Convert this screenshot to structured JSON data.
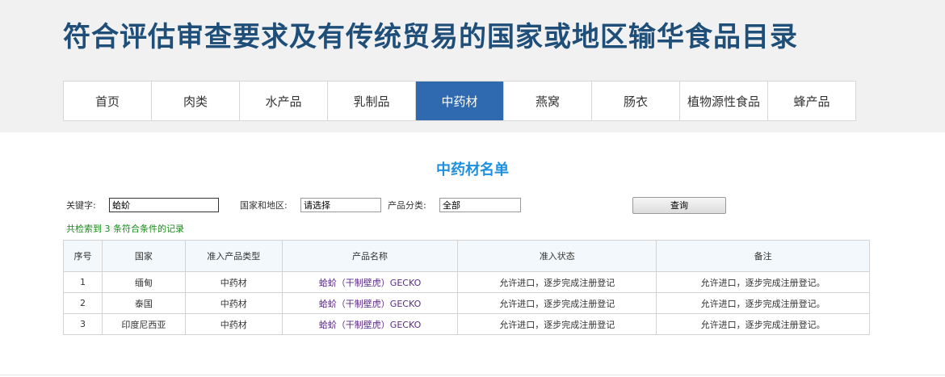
{
  "header": {
    "title": "符合评估审查要求及有传统贸易的国家或地区输华食品目录"
  },
  "nav": {
    "active_index": 4,
    "items": [
      "首页",
      "肉类",
      "水产品",
      "乳制品",
      "中药材",
      "燕窝",
      "肠衣",
      "植物源性食品",
      "蜂产品"
    ]
  },
  "section": {
    "title": "中药材名单"
  },
  "search": {
    "keyword_label": "关键字:",
    "keyword_value": "蛤蚧",
    "region_label": "国家和地区:",
    "region_value": "请选择",
    "category_label": "产品分类:",
    "category_value": "全部",
    "query_button": "查询"
  },
  "results": {
    "summary": "共检索到 3 条符合条件的记录",
    "columns": [
      "序号",
      "国家",
      "准入产品类型",
      "产品名称",
      "准入状态",
      "备注"
    ],
    "rows": [
      [
        "1",
        "缅甸",
        "中药材",
        "蛤蚧（干制壁虎）GECKO",
        "允许进口，逐步完成注册登记",
        "允许进口，逐步完成注册登记。"
      ],
      [
        "2",
        "泰国",
        "中药材",
        "蛤蚧（干制壁虎）GECKO",
        "允许进口，逐步完成注册登记",
        "允许进口，逐步完成注册登记。"
      ],
      [
        "3",
        "印度尼西亚",
        "中药材",
        "蛤蚧（干制壁虎）GECKO",
        "允许进口，逐步完成注册登记",
        "允许进口，逐步完成注册登记。"
      ]
    ]
  },
  "colors": {
    "title": "#1f4e79",
    "nav_active": "#2f6ab0",
    "section_title": "#1e90e0",
    "result_summary": "#1b8a1b",
    "product_name": "#5b2a86"
  }
}
